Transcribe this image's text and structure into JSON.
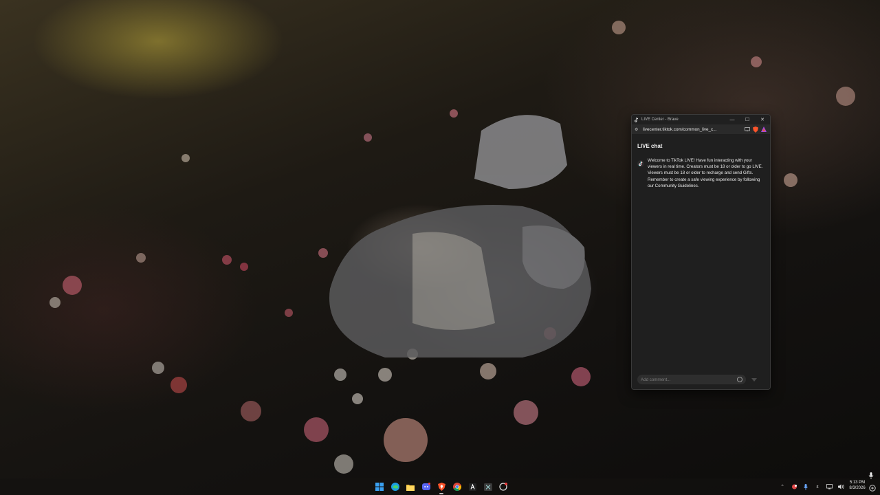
{
  "window": {
    "title": "LIVE Center - Brave",
    "url": "livecenter.tiktok.com/common_live_c...",
    "controls": {
      "minimize": "—",
      "maximize": "☐",
      "close": "✕"
    }
  },
  "live_chat": {
    "heading": "LIVE chat",
    "welcome_message": "Welcome to TikTok LIVE! Have fun interacting with your viewers in real time. Creators must be 18 or older to go LIVE. Viewers must be 18 or older to recharge and send Gifts. Remember to create a safe viewing experience by following our Community Guidelines.",
    "comment_placeholder": "Add comment..."
  },
  "taskbar": {
    "apps": [
      "windows-start",
      "edge",
      "file-explorer",
      "discord",
      "brave",
      "chrome",
      "notion",
      "excel",
      "capcut"
    ],
    "clock": {
      "time": "5:13 PM",
      "date": "8/3/2026"
    }
  },
  "colors": {
    "window_bg": "#1f1f1f",
    "brave_orange": "#fb542b",
    "tiktok_pink": "#fe2c55",
    "tiktok_cyan": "#25f4ee"
  }
}
